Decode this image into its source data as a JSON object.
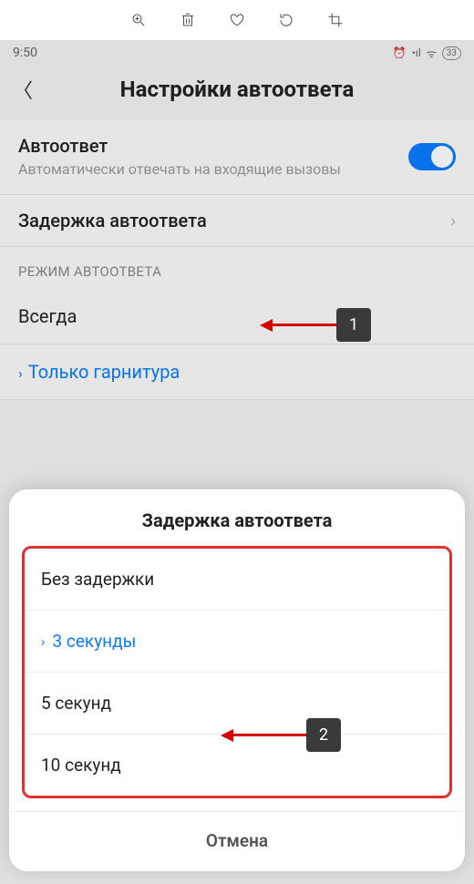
{
  "toolbar": {
    "icons": [
      "zoom",
      "trash",
      "heart",
      "rotate",
      "crop"
    ]
  },
  "status": {
    "time": "9:50",
    "battery": "33"
  },
  "header": {
    "title": "Настройки автоответа"
  },
  "settings": {
    "auto_answer": {
      "title": "Автоответ",
      "description": "Автоматически отвечать на входящие вызовы",
      "enabled": true
    },
    "delay_row": {
      "title": "Задержка автоответа"
    },
    "mode_section": "РЕЖИМ АВТООТВЕТА",
    "mode_options": {
      "always": "Всегда",
      "headset_only": "Только гарнитура"
    }
  },
  "modal": {
    "title": "Задержка автоответа",
    "options": {
      "none": "Без задержки",
      "sec3": "3 секунды",
      "sec5": "5 секунд",
      "sec10": "10 секунд"
    },
    "cancel": "Отмена"
  },
  "annotations": {
    "badge1": "1",
    "badge2": "2"
  }
}
